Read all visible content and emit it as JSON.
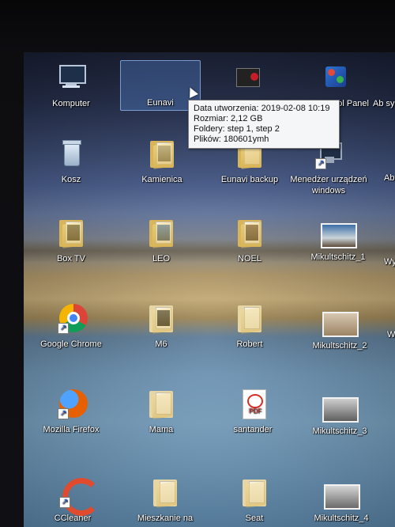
{
  "desktop": {
    "icons": [
      {
        "label": "Komputer",
        "type": "system-icon"
      },
      {
        "label": "Eunavi",
        "type": "folder-icon"
      },
      {
        "label": "ol Panel",
        "type": "control-panel-icon"
      },
      {
        "label": "Ab sys",
        "type": "shortcut-icon"
      },
      {
        "label": "Kosz",
        "type": "recycle-bin-icon"
      },
      {
        "label": "Kamienica",
        "type": "folder-icon"
      },
      {
        "label": "Eunavi backup",
        "type": "folder-icon"
      },
      {
        "label": "Menedżer urządzeń windows",
        "type": "device-manager-icon"
      },
      {
        "label": "Ab",
        "type": "shortcut-icon"
      },
      {
        "label": "Box TV",
        "type": "folder-icon"
      },
      {
        "label": "LEO",
        "type": "folder-icon"
      },
      {
        "label": "NOEL",
        "type": "folder-icon"
      },
      {
        "label": "Mikultschitz_1",
        "type": "image-icon"
      },
      {
        "label": "Wy",
        "type": "shortcut-icon"
      },
      {
        "label": "Google Chrome",
        "type": "chrome-icon"
      },
      {
        "label": "M6",
        "type": "folder-icon"
      },
      {
        "label": "Robert",
        "type": "folder-icon"
      },
      {
        "label": "Mikultschitz_2",
        "type": "image-icon"
      },
      {
        "label": "W",
        "type": "shortcut-icon"
      },
      {
        "label": "Mozilla Firefox",
        "type": "firefox-icon"
      },
      {
        "label": "Mama",
        "type": "folder-icon"
      },
      {
        "label": "santander",
        "type": "pdf-icon"
      },
      {
        "label": "Mikultschitz_3",
        "type": "image-icon"
      },
      {
        "label": "CCleaner",
        "type": "ccleaner-icon"
      },
      {
        "label": "Mieszkanie na",
        "type": "folder-icon"
      },
      {
        "label": "Seat",
        "type": "folder-icon"
      },
      {
        "label": "Mikultschitz_4",
        "type": "image-icon"
      }
    ],
    "tooltip": {
      "line1": "Data utworzenia: 2019-02-08 10:19",
      "line2": "Rozmiar: 2,12 GB",
      "line3": "Foldery: step 1, step 2",
      "line4": "Plików: 180601ymh"
    }
  }
}
